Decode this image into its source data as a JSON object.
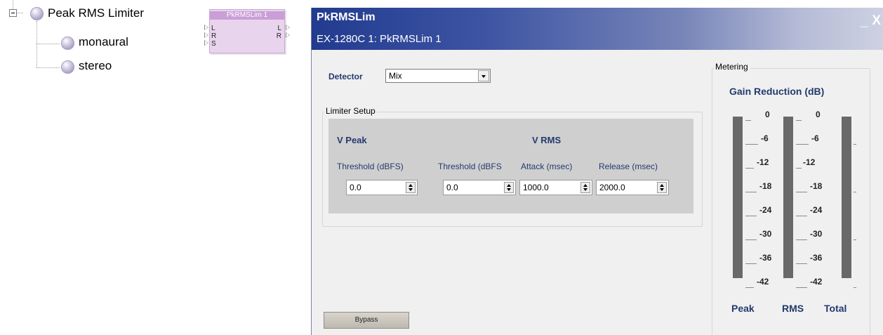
{
  "tree": {
    "root_label": "Peak RMS Limiter",
    "children": [
      "monaural",
      "stereo"
    ]
  },
  "block": {
    "title": "PkRMSLim 1",
    "inputs": [
      "L",
      "R",
      "S"
    ],
    "outputs": [
      "L",
      "R"
    ]
  },
  "window": {
    "title": "PkRMSLim",
    "subtitle": "EX-1280C 1: PkRMSLim 1",
    "minimize": "_",
    "close": "X"
  },
  "detector": {
    "label": "Detector",
    "value": "Mix"
  },
  "limiter_setup": {
    "legend": "Limiter Setup",
    "vpeak_heading": "V Peak",
    "vrms_heading": "V RMS",
    "fields": [
      {
        "label": "Threshold (dBFS)",
        "value": "0.0"
      },
      {
        "label": "Threshold (dBFS",
        "value": "0.0"
      },
      {
        "label": "Attack (msec)",
        "value": "1000.0"
      },
      {
        "label": "Release (msec)",
        "value": "2000.0"
      }
    ]
  },
  "bypass": {
    "label": "Bypass"
  },
  "metering": {
    "legend": "Metering",
    "title": "Gain Reduction (dB)",
    "scale": [
      "0",
      "-6",
      "-12",
      "-18",
      "-24",
      "-30",
      "-36",
      "-42"
    ],
    "meters": [
      "Peak",
      "RMS",
      "Total"
    ]
  },
  "colors": {
    "titlebar_start": "#223b8e",
    "titlebar_end": "#cdd1e2",
    "heading_text": "#233a6e",
    "meter_bar": "#696969",
    "block_fill": "#e9d4ee"
  }
}
